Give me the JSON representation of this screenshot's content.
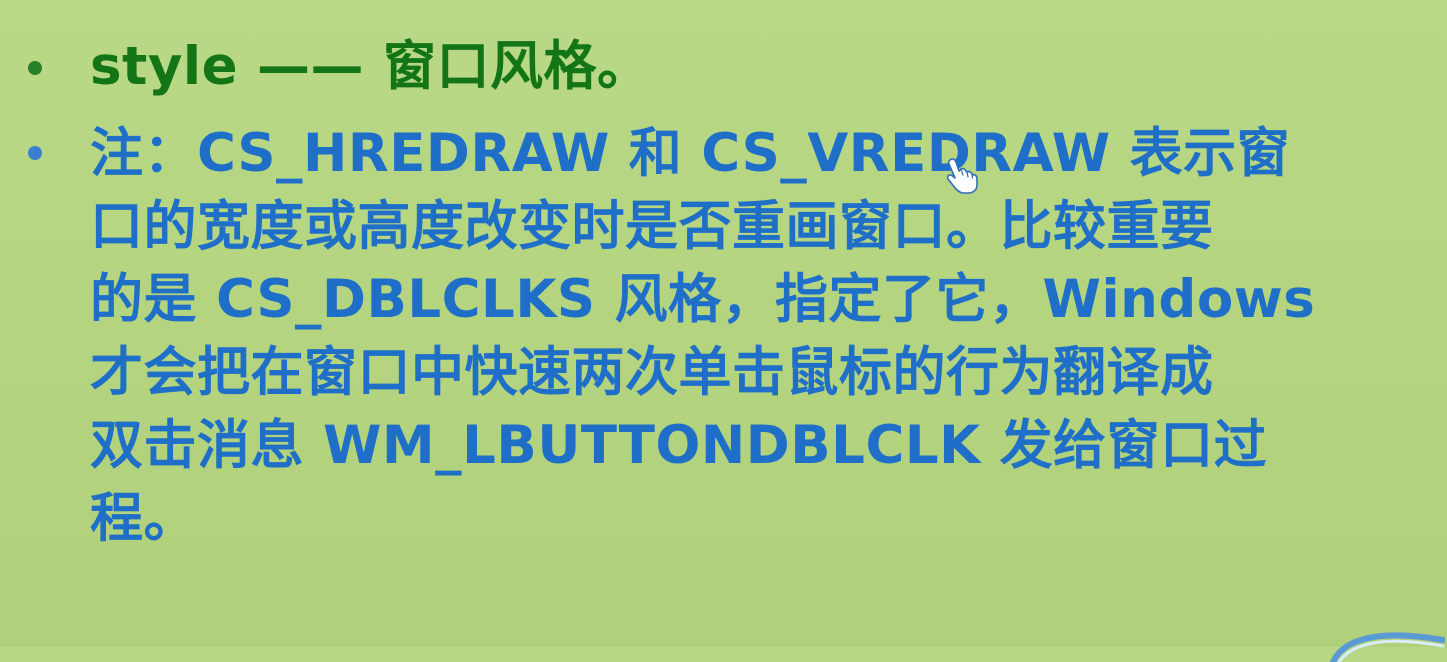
{
  "bullets": [
    {
      "lines": [
        "style —— 窗口风格。"
      ],
      "color": "#137516"
    },
    {
      "lines": [
        "注：CS_HREDRAW 和 CS_VREDRAW 表示窗",
        "口的宽度或高度改变时是否重画窗口。比较重要",
        "的是 CS_DBLCLKS 风格，指定了它，Windows",
        "才会把在窗口中快速两次单击鼠标的行为翻译成",
        "双击消息 WM_LBUTTONDBLCLK 发给窗口过",
        "程。"
      ],
      "color": "#1f6fc8"
    }
  ],
  "cursor_icon": "hand-pointer-icon",
  "background_color": "#b7d785"
}
